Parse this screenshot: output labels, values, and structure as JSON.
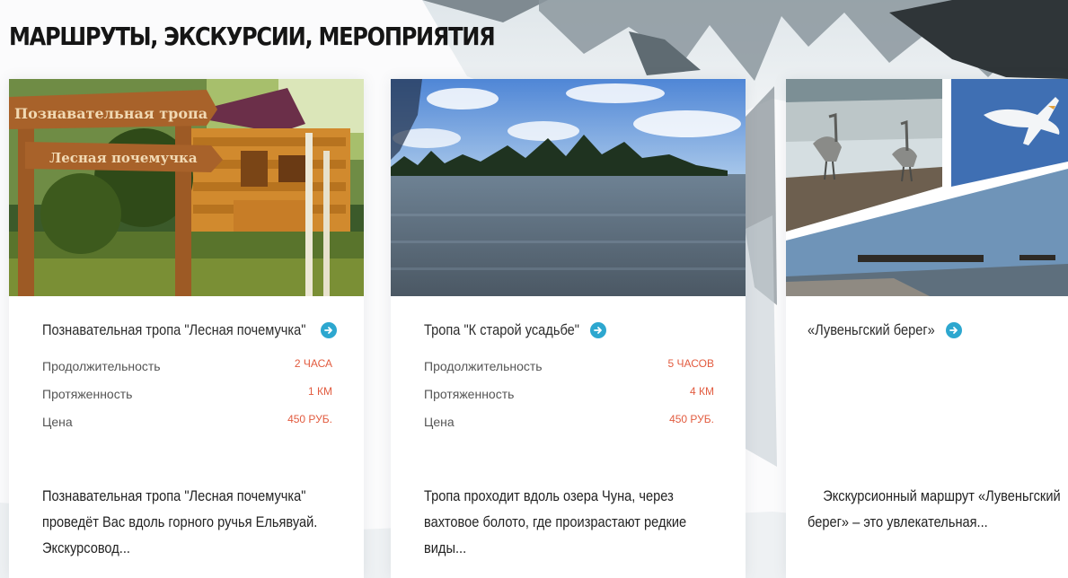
{
  "page": {
    "title": "МАРШРУТЫ, ЭКСКУРСИИ, МЕРОПРИЯТИЯ"
  },
  "colors": {
    "accent": "#2da7cf",
    "spec_value": "#e25b3f",
    "card_bg": "#ffffff"
  },
  "cards": [
    {
      "title": "Познавательная тропа \"Лесная почемучка\"",
      "image_name": "forest-trail-photo",
      "image_signs": [
        "Познавательная тропа",
        "Лесная почемучка"
      ],
      "specs": [
        {
          "label": "Продолжительность",
          "value": "2 ЧАСА"
        },
        {
          "label": "Протяженность",
          "value": "1 КМ"
        },
        {
          "label": "Цена",
          "value": "450 РУБ."
        }
      ],
      "description": "Познавательная тропа \"Лесная почемучка\" проведёт Вас вдоль горного ручья Ельявуай. Экскурсовод..."
    },
    {
      "title": "Тропа \"К старой усадьбе\"",
      "image_name": "lake-photo",
      "specs": [
        {
          "label": "Продолжительность",
          "value": "5 ЧАСОВ"
        },
        {
          "label": "Протяженность",
          "value": "4 КМ"
        },
        {
          "label": "Цена",
          "value": "450 РУБ."
        }
      ],
      "description": "Тропа проходит вдоль озера Чуна, через вахтовое болото, где  произрастают редкие виды..."
    },
    {
      "title": "«Лувеньгский берег»",
      "image_name": "birds-collage-photo",
      "specs": [],
      "description": "Экскурсионный маршрут «Лувеньгский берег» – это увлекательная..."
    }
  ]
}
